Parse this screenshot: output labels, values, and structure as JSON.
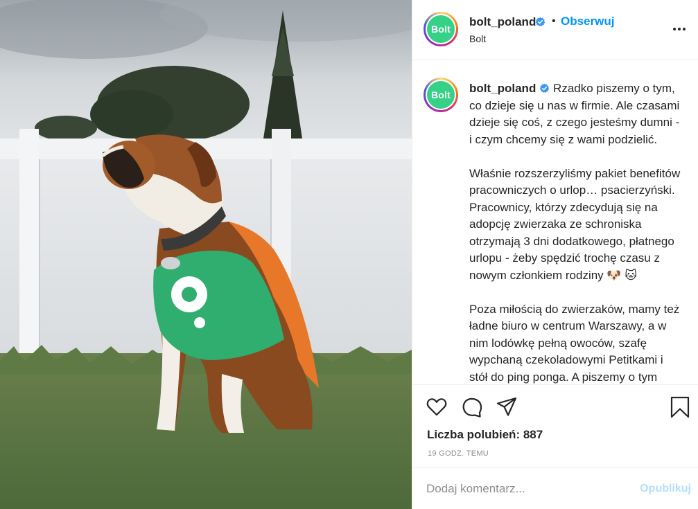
{
  "photo": {
    "vest_color": "#2fae6f",
    "cape_color": "#e7782a"
  },
  "account": {
    "username": "bolt_poland",
    "subtitle": "Bolt",
    "follow_label": "Obserwuj",
    "separator": "•",
    "more_label": "...",
    "avatar_text": "Bolt",
    "brand_color": "#34d186",
    "verified_color": "#3897f0"
  },
  "caption": {
    "username": "bolt_poland",
    "text": " Rzadko piszemy o tym, co dzieje się u nas w firmie. Ale czasami dzieje się coś, z czego jesteśmy dumni - i czym chcemy się z wami podzielić.\n\nWłaśnie rozszerzyliśmy pakiet benefitów pracowniczych o urlop… psacierzyński. Pracownicy, którzy zdecydują się na adopcję zwierzaka ze schroniska otrzymają 3 dni dodatkowego, płatnego urlopu - żeby spędzić trochę czasu z nowym członkiem rodziny 🐶 🐱\n\nPoza miłością do zwierzaków, mamy też ładne biuro w centrum Warszawy, a w nim lodówkę pełną owoców, szafę wypchaną czekoladowymi Petitkami i stół do ping ponga. A piszemy o tym"
  },
  "actions": {
    "icons": [
      "heart-icon",
      "comment-icon",
      "share-icon",
      "bookmark-icon"
    ],
    "likes": "Liczba polubień: 887",
    "time": "19 GODZ. TEMU"
  },
  "comment": {
    "placeholder": "Dodaj komentarz...",
    "publish_label": "Opublikuj",
    "publish_color": "#b2dffc"
  }
}
